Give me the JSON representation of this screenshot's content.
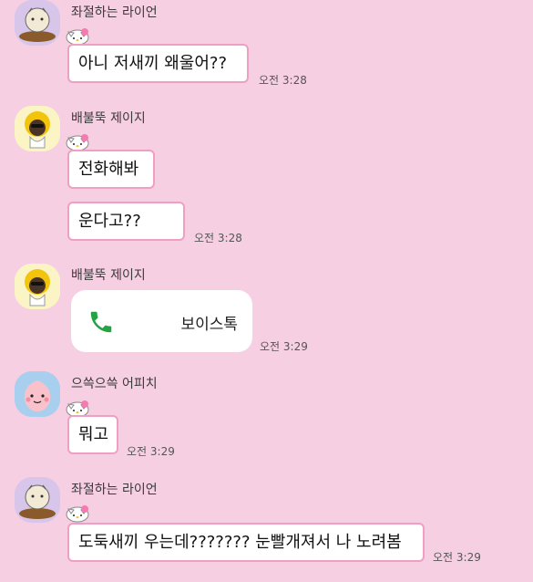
{
  "messages": [
    {
      "sender": "좌절하는 라이언",
      "text": "아니 저새끼 왜울어??",
      "time": "오전 3:28"
    },
    {
      "sender": "배불뚝 제이지",
      "text": "전화해봐"
    },
    {
      "text": "운다고??",
      "time": "오전 3:28"
    },
    {
      "sender": "배불뚝 제이지",
      "call_label": "보이스톡",
      "time": "오전 3:29"
    },
    {
      "sender": "으쓱으쓱 어피치",
      "text": "뭐고",
      "time": "오전 3:29"
    },
    {
      "sender": "좌절하는 라이언",
      "text": "도둑새끼 우는데??????? 눈빨개져서 나 노려봄",
      "time": "오전 3:29"
    }
  ],
  "icons": {
    "call": "phone-icon",
    "decor": "hello-kitty-icon",
    "avatar_ryan": "ryan-avatar-icon",
    "avatar_jayg": "jayg-avatar-icon",
    "avatar_apeach": "apeach-avatar-icon"
  },
  "colors": {
    "background": "#f7cfe2",
    "bubble_border": "#ef9fc4",
    "call_icon": "#25a244"
  }
}
